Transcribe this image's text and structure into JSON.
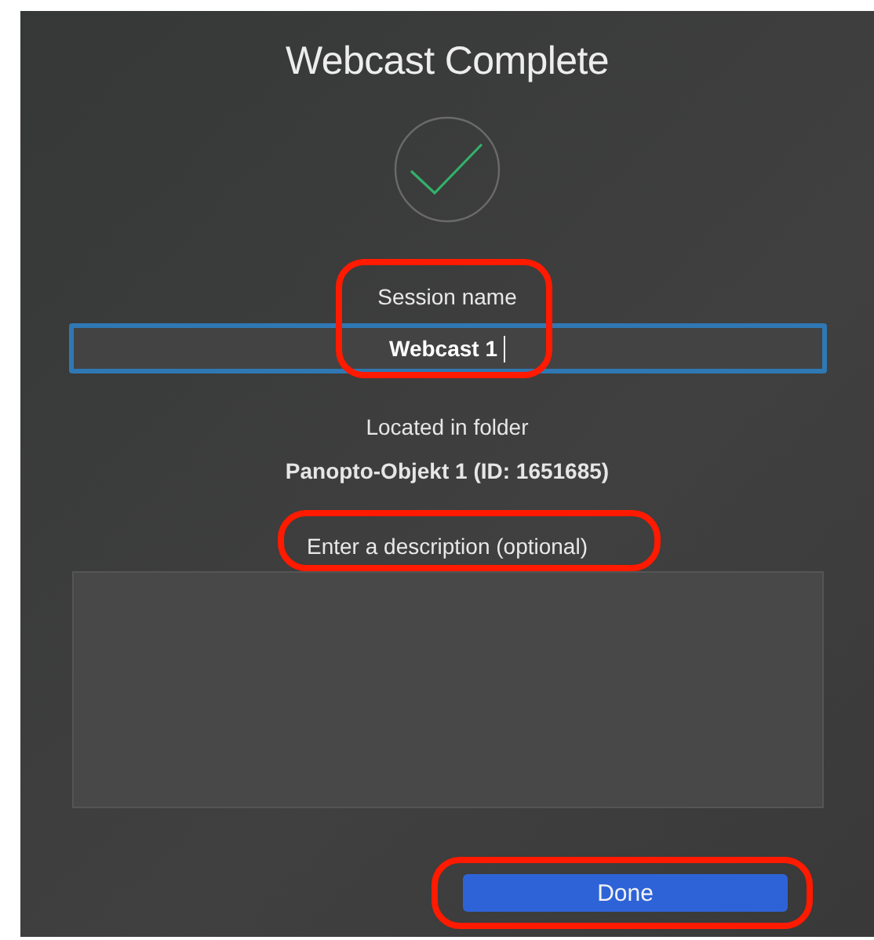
{
  "dialog": {
    "title": "Webcast Complete"
  },
  "session_name": {
    "label": "Session name",
    "value": "Webcast 1",
    "focused": true,
    "highlighted": true
  },
  "folder": {
    "label": "Located in folder",
    "value": "Panopto-Objekt 1 (ID: 1651685)"
  },
  "description": {
    "label": "Enter a description (optional)",
    "highlighted": true
  },
  "buttons": [
    {
      "label": "Done",
      "kind": "primary",
      "highlighted": true
    }
  ]
}
